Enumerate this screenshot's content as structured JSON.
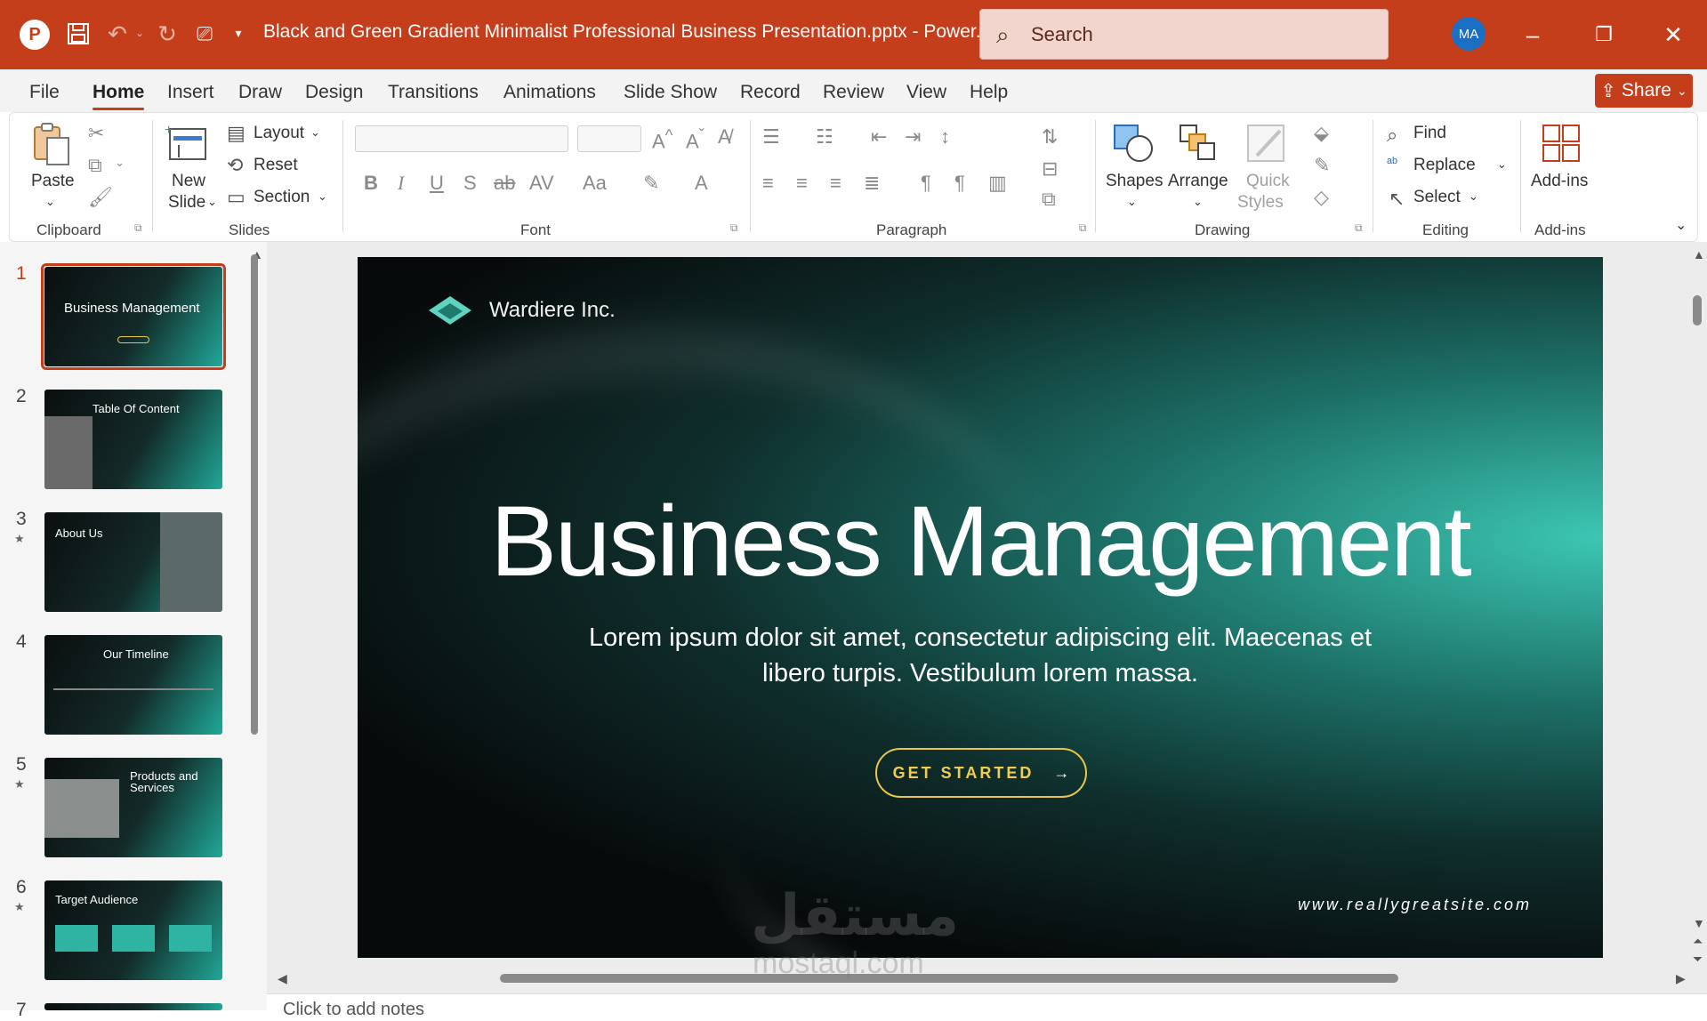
{
  "titlebar": {
    "document_title": "Black and Green Gradient Minimalist Professional Business Presentation.pptx  -  Power...",
    "search_placeholder": "Search",
    "user_initials": "MA",
    "color": "#c43e1c"
  },
  "menu_tabs": [
    "File",
    "Home",
    "Insert",
    "Draw",
    "Design",
    "Transitions",
    "Animations",
    "Slide Show",
    "Record",
    "Review",
    "View",
    "Help"
  ],
  "active_tab": "Home",
  "share_label": "Share",
  "ribbon": {
    "clipboard": {
      "paste": "Paste",
      "group": "Clipboard"
    },
    "slides": {
      "new_slide_1": "New",
      "new_slide_2": "Slide",
      "layout": "Layout",
      "reset": "Reset",
      "section": "Section",
      "group": "Slides"
    },
    "font": {
      "group": "Font"
    },
    "paragraph": {
      "group": "Paragraph"
    },
    "drawing": {
      "shapes": "Shapes",
      "arrange": "Arrange",
      "quick_1": "Quick",
      "quick_2": "Styles",
      "group": "Drawing"
    },
    "editing": {
      "find": "Find",
      "replace": "Replace",
      "select": "Select",
      "group": "Editing"
    },
    "addins": {
      "label": "Add-ins",
      "group": "Add-ins"
    }
  },
  "thumbnails": [
    {
      "num": "1",
      "title": "Business Management",
      "star": ""
    },
    {
      "num": "2",
      "title": "Table Of Content",
      "star": ""
    },
    {
      "num": "3",
      "title": "About Us",
      "star": "★"
    },
    {
      "num": "4",
      "title": "Our Timeline",
      "star": ""
    },
    {
      "num": "5",
      "title": "Products and Services",
      "star": "★"
    },
    {
      "num": "6",
      "title": "Target Audience",
      "star": "★"
    },
    {
      "num": "7",
      "title": "",
      "star": ""
    }
  ],
  "slide": {
    "company": "Wardiere Inc.",
    "title": "Business Management",
    "subtitle_1": "Lorem ipsum dolor sit amet, consectetur adipiscing elit. Maecenas et",
    "subtitle_2": "libero turpis. Vestibulum lorem massa.",
    "cta": "GET STARTED",
    "website": "www.reallygreatsite.com"
  },
  "watermark": {
    "arabic": "مستقل",
    "latin": "mostaql.com"
  },
  "notes_placeholder": "Click to add notes"
}
